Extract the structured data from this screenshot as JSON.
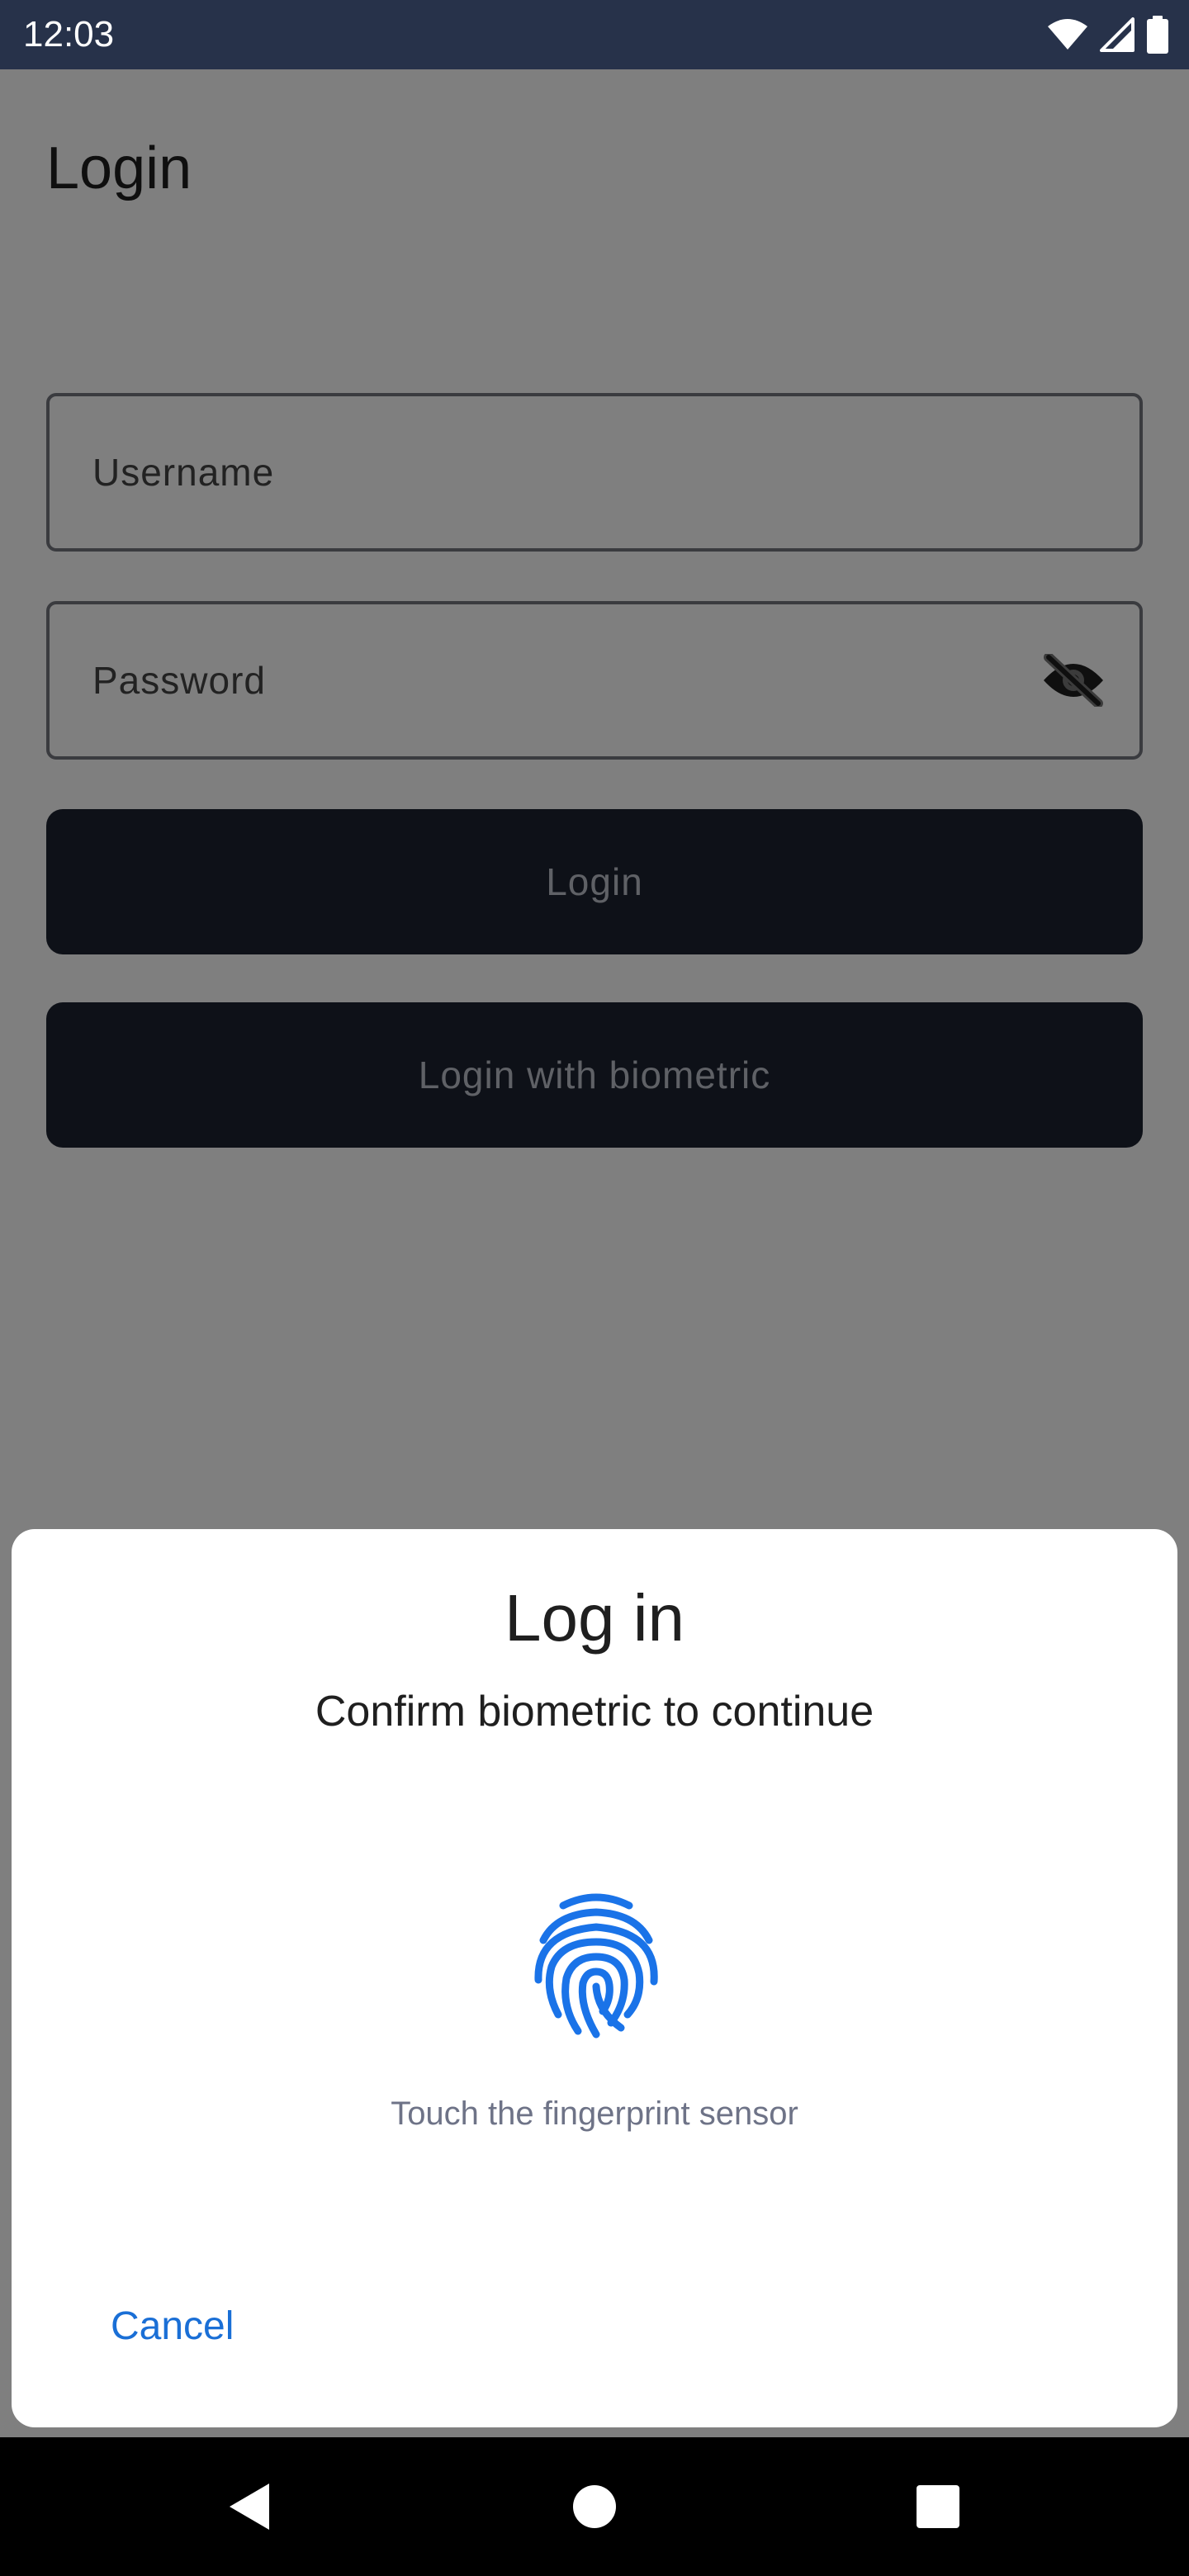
{
  "status_bar": {
    "time": "12:03",
    "icons": [
      "wifi-icon",
      "cell-signal-icon",
      "battery-icon"
    ]
  },
  "app": {
    "title": "Login",
    "username": {
      "placeholder": "Username",
      "value": ""
    },
    "password": {
      "placeholder": "Password",
      "value": "",
      "toggle_icon": "visibility-off-icon"
    },
    "login_button": "Login",
    "biometric_button": "Login with biometric"
  },
  "biometric_prompt": {
    "title": "Log in",
    "subtitle": "Confirm biometric to continue",
    "icon": "fingerprint-icon",
    "hint": "Touch the fingerprint sensor",
    "cancel": "Cancel"
  },
  "navigation": {
    "icons": [
      "back-icon",
      "home-icon",
      "recents-icon"
    ]
  },
  "colors": {
    "status_bar": "#27324a",
    "button_bg": "#1d2230",
    "accent": "#1a6fd6",
    "fingerprint": "#1a73e8"
  }
}
